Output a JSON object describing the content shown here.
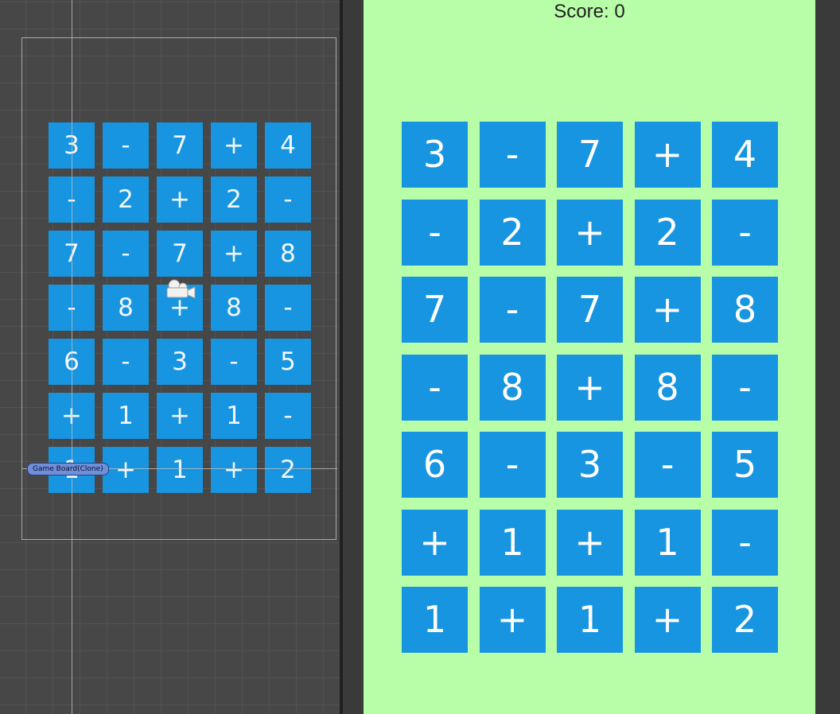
{
  "scene": {
    "object_label": "Game Board(Clone)"
  },
  "game": {
    "score_text": "Score: 0"
  },
  "board": {
    "rows": [
      [
        "3",
        "-",
        "7",
        "+",
        "4"
      ],
      [
        "-",
        "2",
        "+",
        "2",
        "-"
      ],
      [
        "7",
        "-",
        "7",
        "+",
        "8"
      ],
      [
        "-",
        "8",
        "+",
        "8",
        "-"
      ],
      [
        "6",
        "-",
        "3",
        "-",
        "5"
      ],
      [
        "+",
        "1",
        "+",
        "1",
        "-"
      ],
      [
        "1",
        "+",
        "1",
        "+",
        "2"
      ]
    ]
  },
  "colors": {
    "tile": "#1795e0",
    "game_background": "#b8fda8",
    "scene_background": "#474747"
  }
}
